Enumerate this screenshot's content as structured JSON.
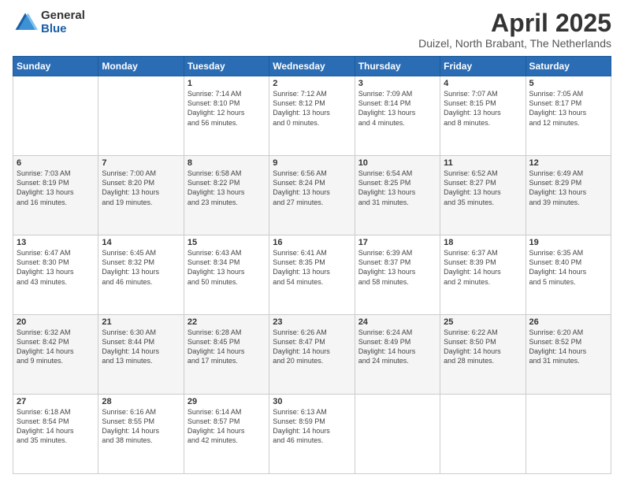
{
  "logo": {
    "general": "General",
    "blue": "Blue"
  },
  "title": {
    "month_year": "April 2025",
    "location": "Duizel, North Brabant, The Netherlands"
  },
  "weekdays": [
    "Sunday",
    "Monday",
    "Tuesday",
    "Wednesday",
    "Thursday",
    "Friday",
    "Saturday"
  ],
  "weeks": [
    [
      {
        "day": "",
        "info": ""
      },
      {
        "day": "",
        "info": ""
      },
      {
        "day": "1",
        "info": "Sunrise: 7:14 AM\nSunset: 8:10 PM\nDaylight: 12 hours\nand 56 minutes."
      },
      {
        "day": "2",
        "info": "Sunrise: 7:12 AM\nSunset: 8:12 PM\nDaylight: 13 hours\nand 0 minutes."
      },
      {
        "day": "3",
        "info": "Sunrise: 7:09 AM\nSunset: 8:14 PM\nDaylight: 13 hours\nand 4 minutes."
      },
      {
        "day": "4",
        "info": "Sunrise: 7:07 AM\nSunset: 8:15 PM\nDaylight: 13 hours\nand 8 minutes."
      },
      {
        "day": "5",
        "info": "Sunrise: 7:05 AM\nSunset: 8:17 PM\nDaylight: 13 hours\nand 12 minutes."
      }
    ],
    [
      {
        "day": "6",
        "info": "Sunrise: 7:03 AM\nSunset: 8:19 PM\nDaylight: 13 hours\nand 16 minutes."
      },
      {
        "day": "7",
        "info": "Sunrise: 7:00 AM\nSunset: 8:20 PM\nDaylight: 13 hours\nand 19 minutes."
      },
      {
        "day": "8",
        "info": "Sunrise: 6:58 AM\nSunset: 8:22 PM\nDaylight: 13 hours\nand 23 minutes."
      },
      {
        "day": "9",
        "info": "Sunrise: 6:56 AM\nSunset: 8:24 PM\nDaylight: 13 hours\nand 27 minutes."
      },
      {
        "day": "10",
        "info": "Sunrise: 6:54 AM\nSunset: 8:25 PM\nDaylight: 13 hours\nand 31 minutes."
      },
      {
        "day": "11",
        "info": "Sunrise: 6:52 AM\nSunset: 8:27 PM\nDaylight: 13 hours\nand 35 minutes."
      },
      {
        "day": "12",
        "info": "Sunrise: 6:49 AM\nSunset: 8:29 PM\nDaylight: 13 hours\nand 39 minutes."
      }
    ],
    [
      {
        "day": "13",
        "info": "Sunrise: 6:47 AM\nSunset: 8:30 PM\nDaylight: 13 hours\nand 43 minutes."
      },
      {
        "day": "14",
        "info": "Sunrise: 6:45 AM\nSunset: 8:32 PM\nDaylight: 13 hours\nand 46 minutes."
      },
      {
        "day": "15",
        "info": "Sunrise: 6:43 AM\nSunset: 8:34 PM\nDaylight: 13 hours\nand 50 minutes."
      },
      {
        "day": "16",
        "info": "Sunrise: 6:41 AM\nSunset: 8:35 PM\nDaylight: 13 hours\nand 54 minutes."
      },
      {
        "day": "17",
        "info": "Sunrise: 6:39 AM\nSunset: 8:37 PM\nDaylight: 13 hours\nand 58 minutes."
      },
      {
        "day": "18",
        "info": "Sunrise: 6:37 AM\nSunset: 8:39 PM\nDaylight: 14 hours\nand 2 minutes."
      },
      {
        "day": "19",
        "info": "Sunrise: 6:35 AM\nSunset: 8:40 PM\nDaylight: 14 hours\nand 5 minutes."
      }
    ],
    [
      {
        "day": "20",
        "info": "Sunrise: 6:32 AM\nSunset: 8:42 PM\nDaylight: 14 hours\nand 9 minutes."
      },
      {
        "day": "21",
        "info": "Sunrise: 6:30 AM\nSunset: 8:44 PM\nDaylight: 14 hours\nand 13 minutes."
      },
      {
        "day": "22",
        "info": "Sunrise: 6:28 AM\nSunset: 8:45 PM\nDaylight: 14 hours\nand 17 minutes."
      },
      {
        "day": "23",
        "info": "Sunrise: 6:26 AM\nSunset: 8:47 PM\nDaylight: 14 hours\nand 20 minutes."
      },
      {
        "day": "24",
        "info": "Sunrise: 6:24 AM\nSunset: 8:49 PM\nDaylight: 14 hours\nand 24 minutes."
      },
      {
        "day": "25",
        "info": "Sunrise: 6:22 AM\nSunset: 8:50 PM\nDaylight: 14 hours\nand 28 minutes."
      },
      {
        "day": "26",
        "info": "Sunrise: 6:20 AM\nSunset: 8:52 PM\nDaylight: 14 hours\nand 31 minutes."
      }
    ],
    [
      {
        "day": "27",
        "info": "Sunrise: 6:18 AM\nSunset: 8:54 PM\nDaylight: 14 hours\nand 35 minutes."
      },
      {
        "day": "28",
        "info": "Sunrise: 6:16 AM\nSunset: 8:55 PM\nDaylight: 14 hours\nand 38 minutes."
      },
      {
        "day": "29",
        "info": "Sunrise: 6:14 AM\nSunset: 8:57 PM\nDaylight: 14 hours\nand 42 minutes."
      },
      {
        "day": "30",
        "info": "Sunrise: 6:13 AM\nSunset: 8:59 PM\nDaylight: 14 hours\nand 46 minutes."
      },
      {
        "day": "",
        "info": ""
      },
      {
        "day": "",
        "info": ""
      },
      {
        "day": "",
        "info": ""
      }
    ]
  ]
}
